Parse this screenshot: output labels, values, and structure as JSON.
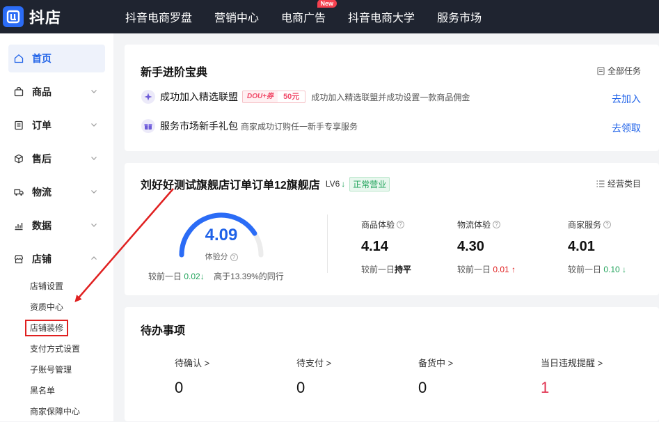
{
  "brand": {
    "logo_text": "抖店",
    "logo_color": "#2b6cf6"
  },
  "nav": {
    "items": [
      {
        "label": "抖音电商罗盘"
      },
      {
        "label": "营销中心"
      },
      {
        "label": "电商广告",
        "badge": "New"
      },
      {
        "label": "抖音电商大学"
      },
      {
        "label": "服务市场"
      }
    ]
  },
  "sidebar": {
    "items": [
      {
        "label": "首页",
        "icon": "home-icon"
      },
      {
        "label": "商品",
        "icon": "bag-icon"
      },
      {
        "label": "订单",
        "icon": "clipboard-icon"
      },
      {
        "label": "售后",
        "icon": "box-icon"
      },
      {
        "label": "物流",
        "icon": "truck-icon"
      },
      {
        "label": "数据",
        "icon": "chart-icon"
      },
      {
        "label": "店铺",
        "icon": "store-icon"
      }
    ],
    "shop_sub": [
      "店铺设置",
      "资质中心",
      "店铺装修",
      "支付方式设置",
      "子账号管理",
      "黑名单",
      "商家保障中心"
    ]
  },
  "guide": {
    "title": "新手进阶宝典",
    "all_tasks": "全部任务",
    "tasks": [
      {
        "name": "成功加入精选联盟",
        "tag_a": "DOU+券",
        "tag_b": "50元",
        "desc": "成功加入精选联盟并成功设置一款商品佣金",
        "action": "去加入"
      },
      {
        "name": "服务市场新手礼包",
        "desc": "商家成功订购任一新手专享服务",
        "action": "去领取"
      }
    ]
  },
  "shop": {
    "name": "刘好好测试旗舰店订单订单12旗舰店",
    "level": "LV6",
    "status": "正常营业",
    "category_link": "经营类目",
    "score": "4.09",
    "score_fraction": 0.818,
    "score_label": "体验分",
    "compare_prefix": "较前一日",
    "compare_value": "0.02",
    "peer_text": "高于13.39%的同行",
    "metrics": [
      {
        "title": "商品体验",
        "value": "4.14",
        "cmp_prefix": "较前一日",
        "cmp_value": "持平",
        "trend": "flat"
      },
      {
        "title": "物流体验",
        "value": "4.30",
        "cmp_prefix": "较前一日",
        "cmp_value": "0.01",
        "trend": "up"
      },
      {
        "title": "商家服务",
        "value": "4.01",
        "cmp_prefix": "较前一日",
        "cmp_value": "0.10",
        "trend": "down"
      }
    ]
  },
  "todo": {
    "title": "待办事项",
    "items": [
      {
        "label": "待确认 >",
        "value": "0"
      },
      {
        "label": "待支付 >",
        "value": "0"
      },
      {
        "label": "备货中 >",
        "value": "0"
      },
      {
        "label": "当日违规提醒 >",
        "value": "1"
      }
    ]
  },
  "colors": {
    "accent": "#1f62e8",
    "green": "#20a35a",
    "red": "#e02020",
    "topbar": "#1f2430"
  }
}
